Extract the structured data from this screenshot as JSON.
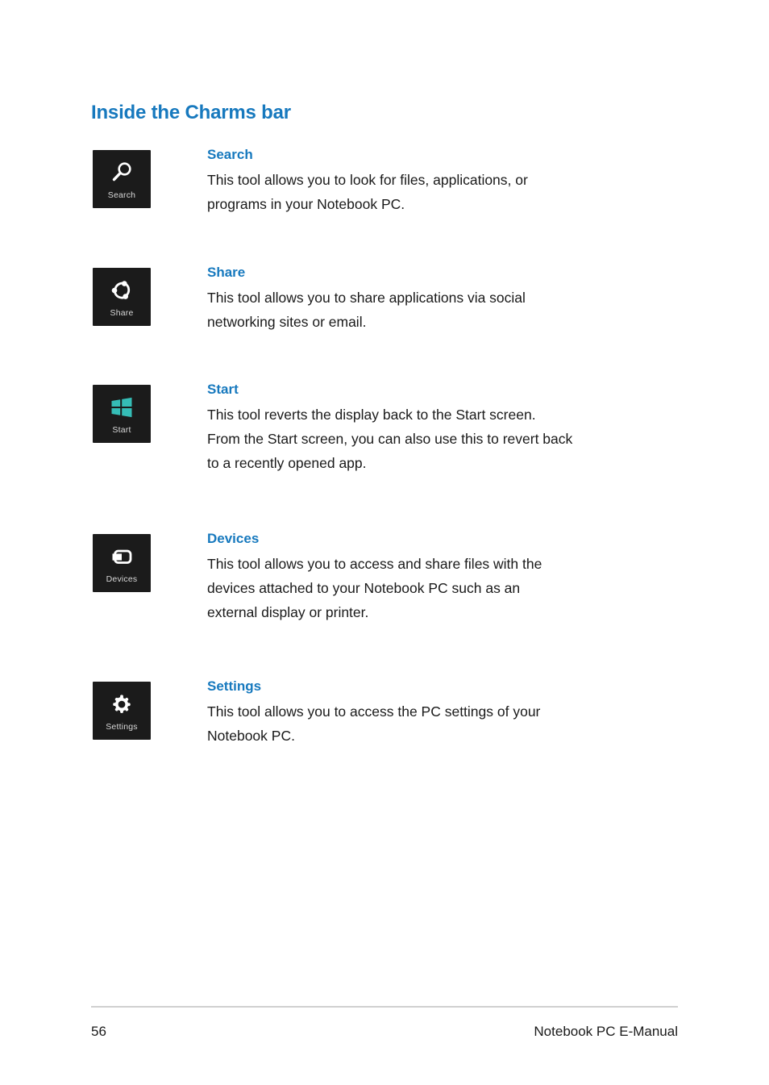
{
  "page": {
    "heading": "Inside the Charms bar",
    "accent_color": "#1779be",
    "text_color": "#1a1a1a",
    "tile_background": "#1b1b1b",
    "tile_label_color": "#d8d8d8",
    "start_logo_color": "#35bdb6"
  },
  "charms": [
    {
      "icon": "search-icon",
      "tile_label": "Search",
      "title": "Search",
      "description": "This tool allows you to look for files, applications, or\nprograms in your Notebook PC."
    },
    {
      "icon": "share-icon",
      "tile_label": "Share",
      "title": "Share",
      "description": "This tool allows you to share applications via social\nnetworking sites or email."
    },
    {
      "icon": "windows-start-icon",
      "tile_label": "Start",
      "title": "Start",
      "description": "This tool reverts the display back to the Start screen.\nFrom the Start screen, you can also use this to revert back\nto a recently opened app."
    },
    {
      "icon": "devices-icon",
      "tile_label": "Devices",
      "title": "Devices",
      "description": "This tool allows you to access and share files with the\ndevices attached to your Notebook PC such as an\nexternal display or printer."
    },
    {
      "icon": "settings-gear-icon",
      "tile_label": "Settings",
      "title": "Settings",
      "description": "This tool allows you to access the PC settings of your\nNotebook PC."
    }
  ],
  "footer": {
    "page_number": "56",
    "document_title": "Notebook PC E-Manual"
  }
}
